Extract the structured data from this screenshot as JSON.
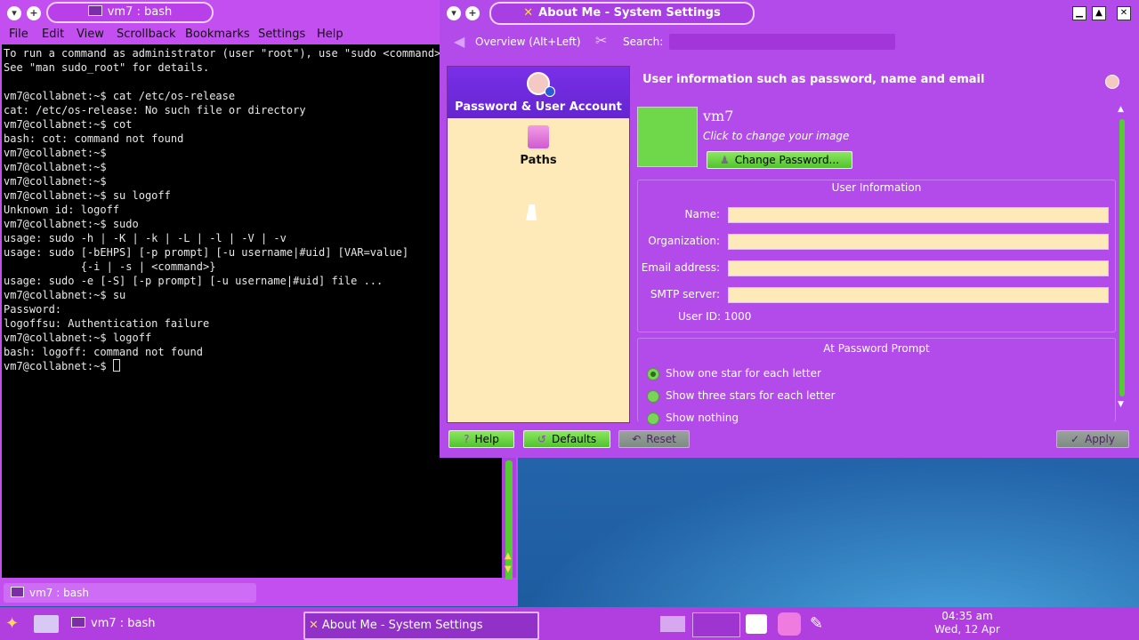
{
  "konsole": {
    "window_title": "vm7 : bash",
    "menu": [
      "File",
      "Edit",
      "View",
      "Scrollback",
      "Bookmarks",
      "Settings",
      "Help"
    ],
    "lines": [
      "To run a command as administrator (user \"root\"), use \"sudo <command>\".",
      "See \"man sudo_root\" for details.",
      "",
      "vm7@collabnet:~$ cat /etc/os-release",
      "cat: /etc/os-release: No such file or directory",
      "vm7@collabnet:~$ cot",
      "bash: cot: command not found",
      "vm7@collabnet:~$",
      "vm7@collabnet:~$",
      "vm7@collabnet:~$",
      "vm7@collabnet:~$ su logoff",
      "Unknown id: logoff",
      "vm7@collabnet:~$ sudo",
      "usage: sudo -h | -K | -k | -L | -l | -V | -v",
      "usage: sudo [-bEHPS] [-p prompt] [-u username|#uid] [VAR=value]",
      "            {-i | -s | <command>}",
      "usage: sudo -e [-S] [-p prompt] [-u username|#uid] file ...",
      "vm7@collabnet:~$ su",
      "Password:",
      "logoffsu: Authentication failure",
      "vm7@collabnet:~$ logoff",
      "bash: logoff: command not found",
      "vm7@collabnet:~$ "
    ],
    "tab_label": "vm7 : bash"
  },
  "settings": {
    "window_title": "About Me - System Settings",
    "toolbar": {
      "overview_label": "Overview (Alt+Left)",
      "search_label": "Search:",
      "search_value": ""
    },
    "sidebar": {
      "items": [
        {
          "label": "Password & User Account",
          "icon": "user-account-icon"
        },
        {
          "label": "Paths",
          "icon": "folder-icon"
        }
      ]
    },
    "content": {
      "heading": "User information such as password, name and email",
      "username": "vm7",
      "change_image_hint": "Click to change your image",
      "change_password_label": "Change Password...",
      "user_info_title": "User Information",
      "fields": [
        {
          "label": "Name:",
          "value": ""
        },
        {
          "label": "Organization:",
          "value": ""
        },
        {
          "label": "Email address:",
          "value": ""
        },
        {
          "label": "SMTP server:",
          "value": ""
        }
      ],
      "user_id": "User ID: 1000",
      "password_prompt_title": "At Password Prompt",
      "radio_options": [
        "Show one star for each letter",
        "Show three stars for each letter",
        "Show nothing"
      ],
      "radio_selected_index": 0
    },
    "buttons": {
      "help": "Help",
      "defaults": "Defaults",
      "reset": "Reset",
      "apply": "Apply"
    }
  },
  "taskbar": {
    "tasks": [
      {
        "label": "vm7 : bash",
        "active": false
      },
      {
        "label": "About Me - System Settings",
        "active": true
      }
    ],
    "clock_time": "04:35 am",
    "clock_date": "Wed, 12 Apr"
  },
  "colors": {
    "window_chrome": "#c34ff0",
    "sidebar_bg": "#fdeab8",
    "accent_green": "#55cc33",
    "selection_purple": "#6425d0"
  }
}
